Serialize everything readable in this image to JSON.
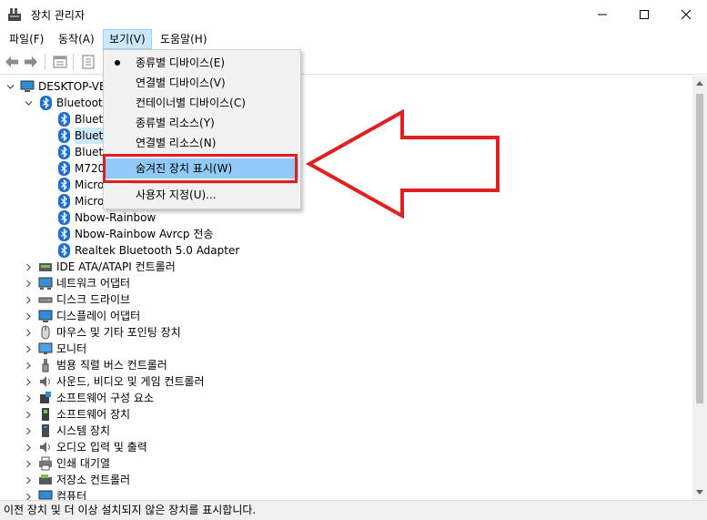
{
  "window": {
    "title": "장치 관리자"
  },
  "menubar": {
    "items": [
      {
        "label": "파일(F)"
      },
      {
        "label": "동작(A)"
      },
      {
        "label": "보기(V)"
      },
      {
        "label": "도움말(H)"
      }
    ]
  },
  "tree": {
    "root": "DESKTOP-VE",
    "bluetooth_category": "Bluetooth",
    "bluetooth_children": [
      "Blueto",
      "Blueto",
      "Blueto",
      "M720",
      "Micro",
      "Micro",
      "Nbow-Rainbow",
      "Nbow-Rainbow Avrcp 전송",
      "Realtek Bluetooth 5.0 Adapter"
    ],
    "categories": [
      {
        "label": "IDE ATA/ATAPI 컨트롤러",
        "icon": "ide-controller-icon"
      },
      {
        "label": "네트워크 어댑터",
        "icon": "network-adapter-icon"
      },
      {
        "label": "디스크 드라이브",
        "icon": "disk-drive-icon"
      },
      {
        "label": "디스플레이 어댑터",
        "icon": "display-adapter-icon"
      },
      {
        "label": "마우스 및 기타 포인팅 장치",
        "icon": "mouse-icon"
      },
      {
        "label": "모니터",
        "icon": "monitor-icon"
      },
      {
        "label": "범용 직렬 버스 컨트롤러",
        "icon": "usb-icon"
      },
      {
        "label": "사운드, 비디오 및 게임 컨트롤러",
        "icon": "speaker-icon"
      },
      {
        "label": "소프트웨어 구성 요소",
        "icon": "software-component-icon"
      },
      {
        "label": "소프트웨어 장치",
        "icon": "software-device-icon"
      },
      {
        "label": "시스템 장치",
        "icon": "system-device-icon"
      },
      {
        "label": "오디오 입력 및 출력",
        "icon": "audio-io-icon"
      },
      {
        "label": "인쇄 대기열",
        "icon": "printer-icon"
      },
      {
        "label": "저장소 컨트롤러",
        "icon": "storage-controller-icon"
      },
      {
        "label": "컴퓨터",
        "icon": "computer-icon"
      }
    ]
  },
  "view_menu": {
    "items": [
      {
        "label": "종류별 디바이스(E)",
        "checked": true
      },
      {
        "label": "연결별 디바이스(V)"
      },
      {
        "label": "컨테이너별 디바이스(C)"
      },
      {
        "label": "종류별 리소스(Y)"
      },
      {
        "label": "연결별 리소스(N)"
      },
      {
        "label": "숨겨진 장치 표시(W)",
        "highlighted": true
      },
      {
        "label": "사용자 지정(U)..."
      }
    ]
  },
  "statusbar": {
    "text": "이전 장치 및 더 이상 설치되지 않은 장치를 표시합니다."
  },
  "colors": {
    "highlight_red": "#e02020",
    "menu_highlight": "#91c9f7",
    "bluetooth_blue": "#1f6fd1"
  }
}
